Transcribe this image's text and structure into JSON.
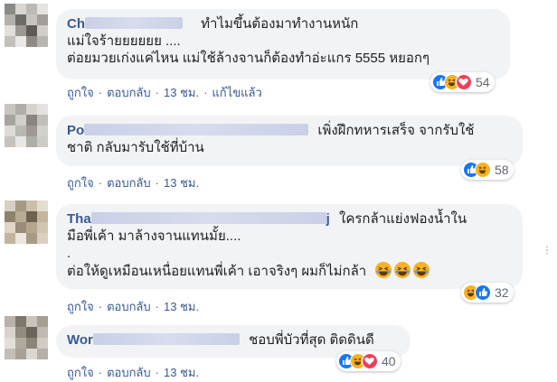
{
  "comments": [
    {
      "author_visible": "Ch",
      "author_tail": "",
      "lines": [
        "ทำไมขึ้นต้องมาทำงานหนัก",
        "แม่ใจร้ายยยยยย ....",
        "ต่อยมวยเก่งแค่ไหน แม่ใช้ล้างจานก็ต้องทำอ่ะแกร 5555 หยอกๆ"
      ],
      "actions": [
        "ถูกใจ",
        "ตอบกลับ",
        "13 ชม.",
        "แก้ไขแล้ว"
      ],
      "reactions": [
        "like",
        "haha",
        "love"
      ],
      "reaction_count": "54"
    },
    {
      "author_visible": "Po",
      "author_tail": "",
      "lines": [
        "เพิ่งฝึกทหารเสร็จ จากรับใช้",
        "ชาติ กลับมารับใช้ที่บ้าน"
      ],
      "actions": [
        "ถูกใจ",
        "ตอบกลับ",
        "13 ชม."
      ],
      "reactions": [
        "like",
        "haha"
      ],
      "reaction_count": "58"
    },
    {
      "author_visible": "Tha",
      "author_tail": "j",
      "lines": [
        "ใครกล้าแย่งฟองน้ำใน",
        "มือพี่เค้า มาล้างจานแทนมั้ย....",
        ".",
        "ต่อให้ดูเหมือนเหนื่อยแทนพี่เค้า เอาจริงๆ ผมก็ไม่กล้า"
      ],
      "actions": [
        "ถูกใจ",
        "ตอบกลับ",
        "13 ชม."
      ],
      "reactions": [
        "haha",
        "like"
      ],
      "reaction_count": "32"
    },
    {
      "author_visible": "Wor",
      "author_tail": "",
      "lines": [
        "ชอบพี่บัวที่สุด ติดดินดี"
      ],
      "actions": [
        "ถูกใจ",
        "ตอบกลับ",
        "13 ชม."
      ],
      "reactions": [
        "like",
        "haha",
        "love"
      ],
      "reaction_count": "40"
    }
  ],
  "colors": {
    "bubble": "#f2f3f5",
    "author": "#385898",
    "meta": "#606770",
    "like": "#1877f2",
    "haha": "#f7b125",
    "love": "#f33e58"
  }
}
